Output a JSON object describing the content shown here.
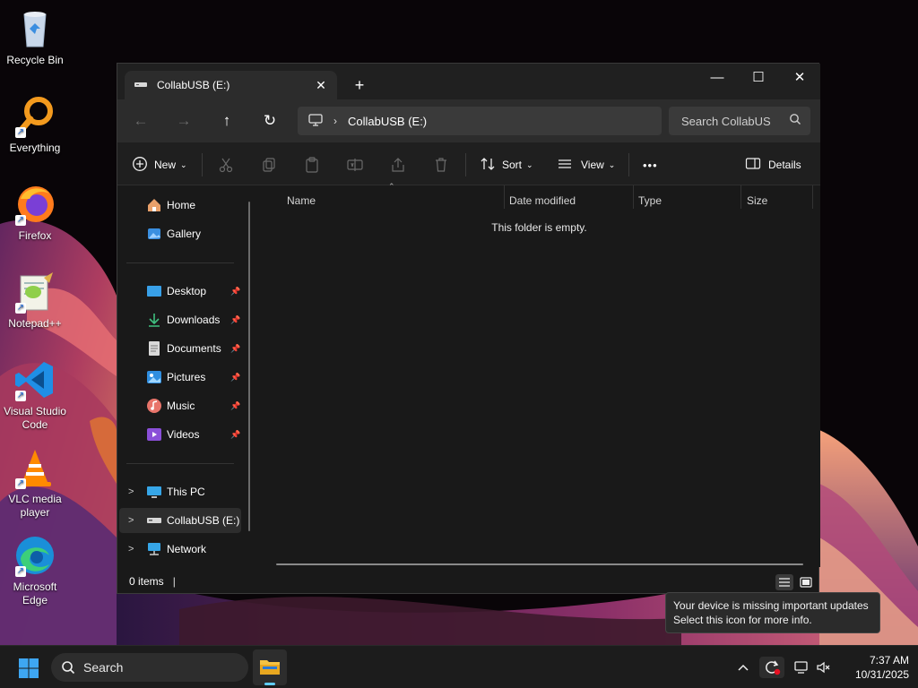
{
  "desktop": {
    "icons": [
      {
        "label": "Recycle Bin",
        "icon": "recycle-bin-icon"
      },
      {
        "label": "Everything",
        "icon": "everything-icon"
      },
      {
        "label": "Firefox",
        "icon": "firefox-icon"
      },
      {
        "label": "Notepad++",
        "icon": "notepad-plus-plus-icon"
      },
      {
        "label": "Visual Studio Code",
        "icon": "vscode-icon"
      },
      {
        "label": "VLC media player",
        "icon": "vlc-icon"
      },
      {
        "label": "Microsoft Edge",
        "icon": "edge-icon"
      }
    ]
  },
  "window": {
    "tab_title": "CollabUSB (E:)",
    "new_tab": "+",
    "controls": {
      "minimize": "—",
      "maximize": "☐",
      "close": "✕"
    },
    "nav": {
      "back": "←",
      "forward": "→",
      "up": "↑",
      "refresh": "↻"
    },
    "address": {
      "chevron": "›",
      "path": "CollabUSB (E:)"
    },
    "search": {
      "placeholder": "Search CollabUS"
    },
    "commands": {
      "new": "New",
      "sort": "Sort",
      "view": "View",
      "more": "•••",
      "details": "Details"
    },
    "sidebar": {
      "quick": [
        {
          "label": "Home",
          "icon": "home-icon"
        },
        {
          "label": "Gallery",
          "icon": "gallery-icon"
        }
      ],
      "pinned": [
        {
          "label": "Desktop",
          "icon": "desktop-folder-icon"
        },
        {
          "label": "Downloads",
          "icon": "downloads-icon"
        },
        {
          "label": "Documents",
          "icon": "documents-icon"
        },
        {
          "label": "Pictures",
          "icon": "pictures-icon"
        },
        {
          "label": "Music",
          "icon": "music-icon"
        },
        {
          "label": "Videos",
          "icon": "videos-icon"
        }
      ],
      "drives": [
        {
          "label": "This PC",
          "icon": "this-pc-icon"
        },
        {
          "label": "CollabUSB (E:)",
          "icon": "usb-drive-icon",
          "selected": true
        },
        {
          "label": "Network",
          "icon": "network-icon"
        }
      ]
    },
    "columns": [
      "Name",
      "Date modified",
      "Type",
      "Size"
    ],
    "empty_message": "This folder is empty.",
    "status": {
      "items": "0 items"
    }
  },
  "tooltip": {
    "line1": "Your device is missing important updates",
    "line2": "Select this icon for more info."
  },
  "taskbar": {
    "search_label": "Search",
    "time": "7:37 AM",
    "date": "10/31/2025"
  },
  "colors": {
    "accent": "#60cdff",
    "window_bg": "#191919",
    "taskbar_bg": "#1c1c1c",
    "update_badge": "#e81123"
  }
}
